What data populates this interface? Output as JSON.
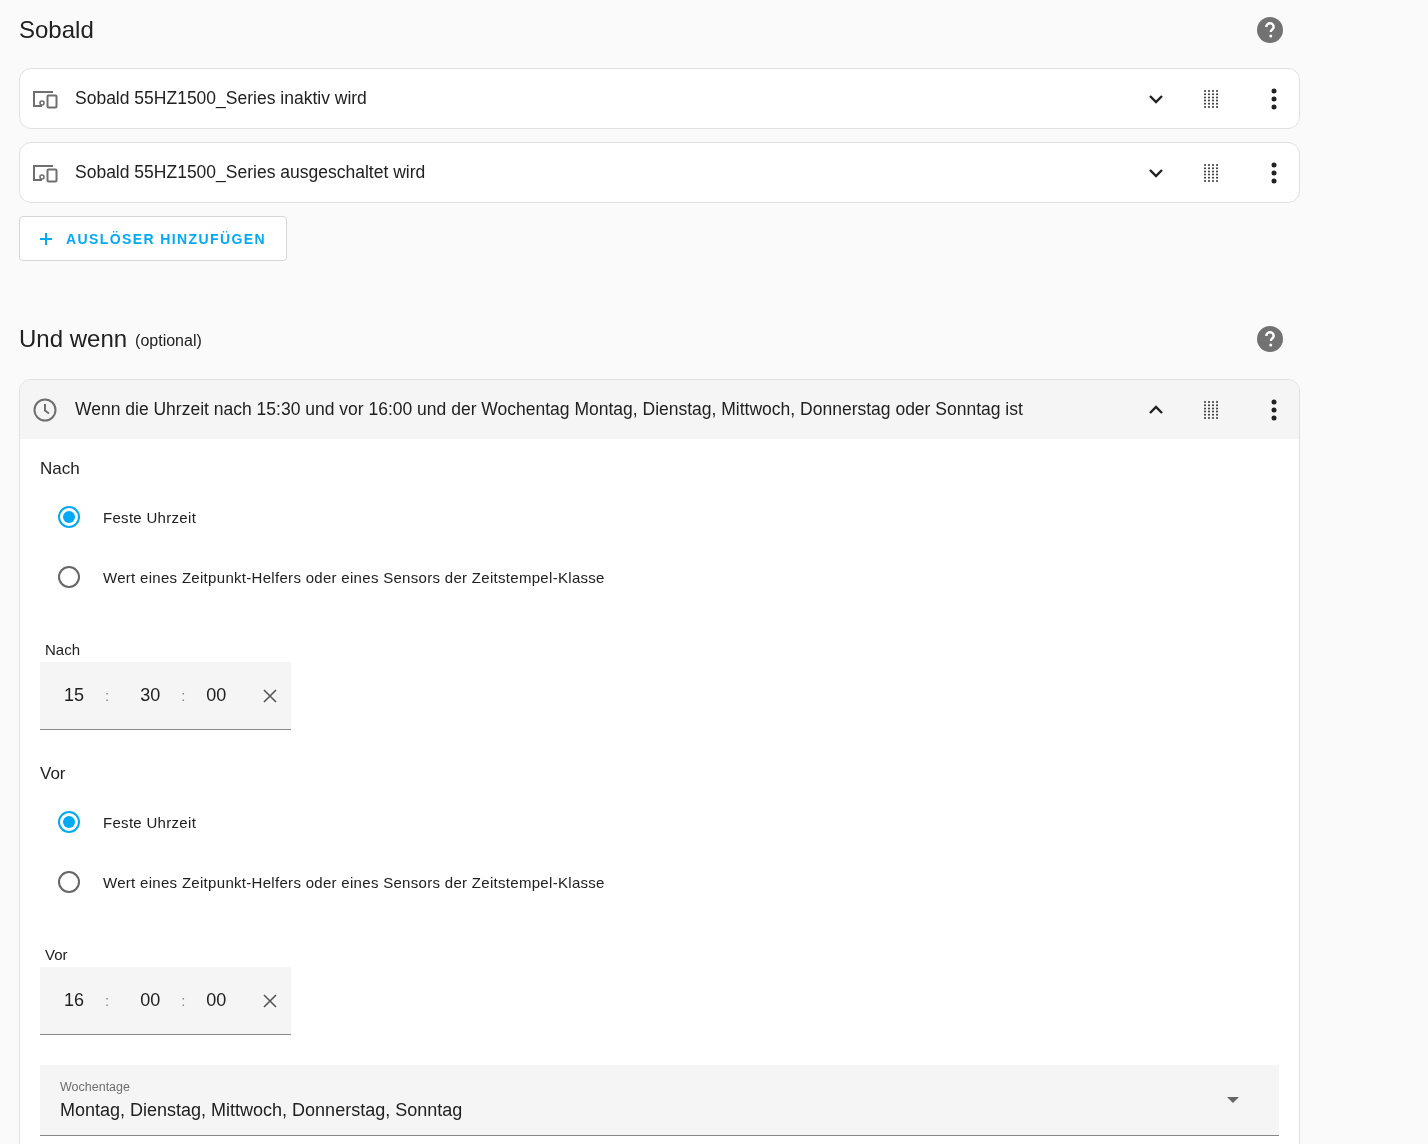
{
  "trigger_section": {
    "title": "Sobald",
    "triggers": [
      {
        "label": "Sobald 55HZ1500_Series inaktiv wird",
        "expanded": false
      },
      {
        "label": "Sobald 55HZ1500_Series ausgeschaltet wird",
        "expanded": false
      }
    ],
    "add_button": "AUSLÖSER HINZUFÜGEN"
  },
  "condition_section": {
    "title": "Und wenn",
    "subtitle": "(optional)",
    "conditions": [
      {
        "label": "Wenn die Uhrzeit nach 15:30 und vor 16:00 und der Wochentag Montag, Dienstag, Mittwoch, Donnerstag oder Sonntag ist",
        "expanded": true,
        "groups": [
          {
            "heading": "Nach",
            "options": [
              {
                "label": "Feste Uhrzeit",
                "selected": true
              },
              {
                "label": "Wert eines Zeitpunkt-Helfers oder eines Sensors der Zeitstempel-Klasse",
                "selected": false
              }
            ],
            "field_label": "Nach",
            "time": [
              {
                "kind": "value",
                "text": "15"
              },
              {
                "kind": "separator",
                "text": ":"
              },
              {
                "kind": "value",
                "text": "30"
              },
              {
                "kind": "separator",
                "text": ":"
              },
              {
                "kind": "value",
                "text": "00"
              }
            ]
          },
          {
            "heading": "Vor",
            "options": [
              {
                "label": "Feste Uhrzeit",
                "selected": true
              },
              {
                "label": "Wert eines Zeitpunkt-Helfers oder eines Sensors der Zeitstempel-Klasse",
                "selected": false
              }
            ],
            "field_label": "Vor",
            "time": [
              {
                "kind": "value",
                "text": "16"
              },
              {
                "kind": "separator",
                "text": ":"
              },
              {
                "kind": "value",
                "text": "00"
              },
              {
                "kind": "separator",
                "text": ":"
              },
              {
                "kind": "value",
                "text": "00"
              }
            ]
          }
        ],
        "weekdays": {
          "label": "Wochentage",
          "value": "Montag, Dienstag, Mittwoch, Donnerstag, Sonntag"
        }
      }
    ]
  }
}
